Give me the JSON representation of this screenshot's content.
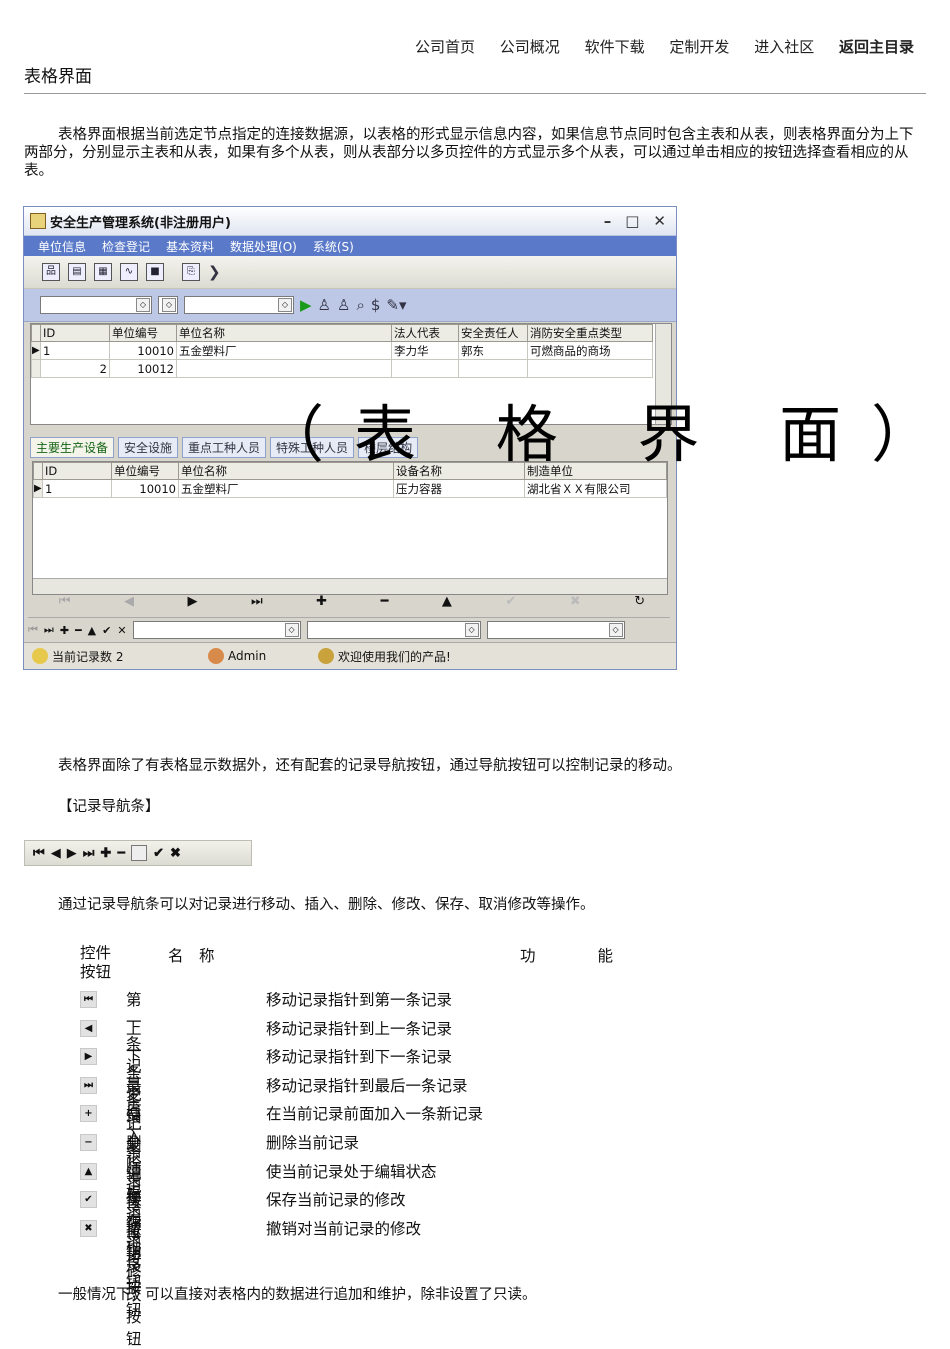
{
  "nav": [
    "公司首页",
    "公司概况",
    "软件下载",
    "定制开发",
    "进入社区",
    "返回主目录"
  ],
  "page_title": "表格界面",
  "intro": "表格界面根据当前选定节点指定的连接数据源，以表格的形式显示信息内容，如果信息节点同时包含主表和从表，则表格界面分为上下两部分，分别显示主表和从表，如果有多个从表，则从表部分以多页控件的方式显示多个从表，可以通过单击相应的按钮选择查看相应的从表。",
  "window": {
    "title": "安全生产管理系统(非注册用户)",
    "menu": [
      "单位信息",
      "检查登记",
      "基本资料",
      "数据处理(O)",
      "系统(S)"
    ],
    "master_columns": [
      "ID",
      "单位编号",
      "单位名称",
      "法人代表",
      "安全责任人",
      "消防安全重点类型"
    ],
    "master_rows": [
      [
        "1",
        "10010",
        "五金塑料厂",
        "李力华",
        "郭东",
        "可燃商品的商场"
      ],
      [
        "2",
        "10012",
        "",
        "",
        "",
        ""
      ]
    ],
    "tabs": [
      "主要生产设备",
      "安全设施",
      "重点工种人员",
      "特殊工种人员",
      "楼层结构"
    ],
    "detail_columns": [
      "ID",
      "单位编号",
      "单位名称",
      "设备名称",
      "制造单位"
    ],
    "detail_rows": [
      [
        "1",
        "10010",
        "五金塑料厂",
        "压力容器",
        "湖北省ＸＸ有限公司"
      ]
    ],
    "status": [
      "当前记录数 2",
      "Admin",
      "欢迎使用我们的产品!"
    ]
  },
  "overlay_text": "（表 格 界 面）",
  "para2": "表格界面除了有表格显示数据外，还有配套的记录导航按钮，通过导航按钮可以控制记录的移动。",
  "nav_heading": "【记录导航条】",
  "para3": "通过记录导航条可以对记录进行移动、插入、删除、修改、保存、取消修改等操作。",
  "controls_header": {
    "col1": "控件按钮",
    "col2": "名　称",
    "col3": "功　　　　能"
  },
  "controls": [
    {
      "icon": "first-record-icon",
      "glyph": "⏮",
      "name": "第一条记录",
      "desc": "移动记录指针到第一条记录"
    },
    {
      "icon": "prior-record-icon",
      "glyph": "◀",
      "name": "上一条记录",
      "desc": "移动记录指针到上一条记录"
    },
    {
      "icon": "next-record-icon",
      "glyph": "▶",
      "name": "下一条记录",
      "desc": "移动记录指针到下一条记录"
    },
    {
      "icon": "last-record-icon",
      "glyph": "⏭",
      "name": "最后一条记录",
      "desc": "移动记录指针到最后一条记录"
    },
    {
      "icon": "insert-record-icon",
      "glyph": "+",
      "name": "插入记录按钮",
      "desc": "在当前记录前面加入一条新记录"
    },
    {
      "icon": "delete-record-icon",
      "glyph": "−",
      "name": "删除记录按钮",
      "desc": "删除当前记录"
    },
    {
      "icon": "edit-record-icon",
      "glyph": "▲",
      "name": "编辑记录按钮",
      "desc": "使当前记录处于编辑状态"
    },
    {
      "icon": "save-record-icon",
      "glyph": "✔",
      "name": "保存记录按钮",
      "desc": "保存当前记录的修改"
    },
    {
      "icon": "cancel-edit-icon",
      "glyph": "✖",
      "name": "撤销修改按钮",
      "desc": "撤销对当前记录的修改"
    }
  ],
  "footer": "一般情况下，可以直接对表格内的数据进行追加和维护，除非设置了只读。"
}
